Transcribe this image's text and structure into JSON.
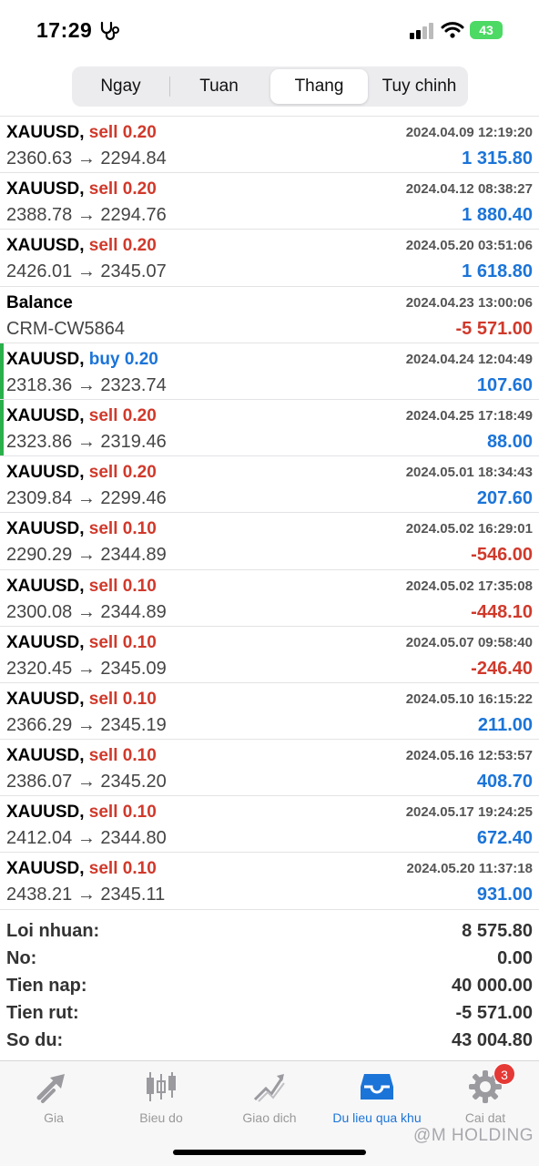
{
  "status_bar": {
    "time": "17:29",
    "battery": "43"
  },
  "segments": [
    "Ngay",
    "Tuan",
    "Thang",
    "Tuy chinh"
  ],
  "active_segment": "Thang",
  "trades": [
    {
      "symbol": "XAUUSD,",
      "side": "sell",
      "volume": "0.20",
      "prices": "2360.63 → 2294.84",
      "time": "2024.04.09 12:19:20",
      "profit": "1 315.80",
      "sign": "pos",
      "marked": false
    },
    {
      "symbol": "XAUUSD,",
      "side": "sell",
      "volume": "0.20",
      "prices": "2388.78 → 2294.76",
      "time": "2024.04.12 08:38:27",
      "profit": "1 880.40",
      "sign": "pos",
      "marked": false
    },
    {
      "symbol": "XAUUSD,",
      "side": "sell",
      "volume": "0.20",
      "prices": "2426.01 → 2345.07",
      "time": "2024.05.20 03:51:06",
      "profit": "1 618.80",
      "sign": "pos",
      "marked": false
    },
    {
      "symbol": "Balance",
      "side": "",
      "volume": "",
      "prices": "CRM-CW5864",
      "time": "2024.04.23 13:00:06",
      "profit": "-5 571.00",
      "sign": "neg",
      "marked": false
    },
    {
      "symbol": "XAUUSD,",
      "side": "buy",
      "volume": "0.20",
      "prices": "2318.36 → 2323.74",
      "time": "2024.04.24 12:04:49",
      "profit": "107.60",
      "sign": "pos",
      "marked": true
    },
    {
      "symbol": "XAUUSD,",
      "side": "sell",
      "volume": "0.20",
      "prices": "2323.86 → 2319.46",
      "time": "2024.04.25 17:18:49",
      "profit": "88.00",
      "sign": "pos",
      "marked": true
    },
    {
      "symbol": "XAUUSD,",
      "side": "sell",
      "volume": "0.20",
      "prices": "2309.84 → 2299.46",
      "time": "2024.05.01 18:34:43",
      "profit": "207.60",
      "sign": "pos",
      "marked": false
    },
    {
      "symbol": "XAUUSD,",
      "side": "sell",
      "volume": "0.10",
      "prices": "2290.29 → 2344.89",
      "time": "2024.05.02 16:29:01",
      "profit": "-546.00",
      "sign": "neg",
      "marked": false
    },
    {
      "symbol": "XAUUSD,",
      "side": "sell",
      "volume": "0.10",
      "prices": "2300.08 → 2344.89",
      "time": "2024.05.02 17:35:08",
      "profit": "-448.10",
      "sign": "neg",
      "marked": false
    },
    {
      "symbol": "XAUUSD,",
      "side": "sell",
      "volume": "0.10",
      "prices": "2320.45 → 2345.09",
      "time": "2024.05.07 09:58:40",
      "profit": "-246.40",
      "sign": "neg",
      "marked": false
    },
    {
      "symbol": "XAUUSD,",
      "side": "sell",
      "volume": "0.10",
      "prices": "2366.29 → 2345.19",
      "time": "2024.05.10 16:15:22",
      "profit": "211.00",
      "sign": "pos",
      "marked": false
    },
    {
      "symbol": "XAUUSD,",
      "side": "sell",
      "volume": "0.10",
      "prices": "2386.07 → 2345.20",
      "time": "2024.05.16 12:53:57",
      "profit": "408.70",
      "sign": "pos",
      "marked": false
    },
    {
      "symbol": "XAUUSD,",
      "side": "sell",
      "volume": "0.10",
      "prices": "2412.04 → 2344.80",
      "time": "2024.05.17 19:24:25",
      "profit": "672.40",
      "sign": "pos",
      "marked": false
    },
    {
      "symbol": "XAUUSD,",
      "side": "sell",
      "volume": "0.10",
      "prices": "2438.21 → 2345.11",
      "time": "2024.05.20 11:37:18",
      "profit": "931.00",
      "sign": "pos",
      "marked": false
    }
  ],
  "summary": [
    {
      "label": "Loi nhuan:",
      "value": "8 575.80"
    },
    {
      "label": "No:",
      "value": "0.00"
    },
    {
      "label": "Tien nap:",
      "value": "40 000.00"
    },
    {
      "label": "Tien rut:",
      "value": "-5 571.00"
    },
    {
      "label": "So du:",
      "value": "43 004.80"
    }
  ],
  "tabs": [
    {
      "label": "Gia",
      "icon": "quotes-arrows-icon"
    },
    {
      "label": "Bieu do",
      "icon": "candlestick-chart-icon"
    },
    {
      "label": "Giao dich",
      "icon": "trade-chart-icon"
    },
    {
      "label": "Du lieu qua khu",
      "icon": "history-inbox-icon"
    },
    {
      "label": "Cai dat",
      "icon": "settings-gear-icon",
      "badge": "3"
    }
  ],
  "active_tab": "Du lieu qua khu",
  "watermark": "@M HOLDING",
  "colors": {
    "sell": "#d0392b",
    "buy": "#1b74d8",
    "positive": "#1b74d8",
    "negative": "#d0392b",
    "accent": "#1b74d8",
    "marker": "#2ab04a"
  }
}
